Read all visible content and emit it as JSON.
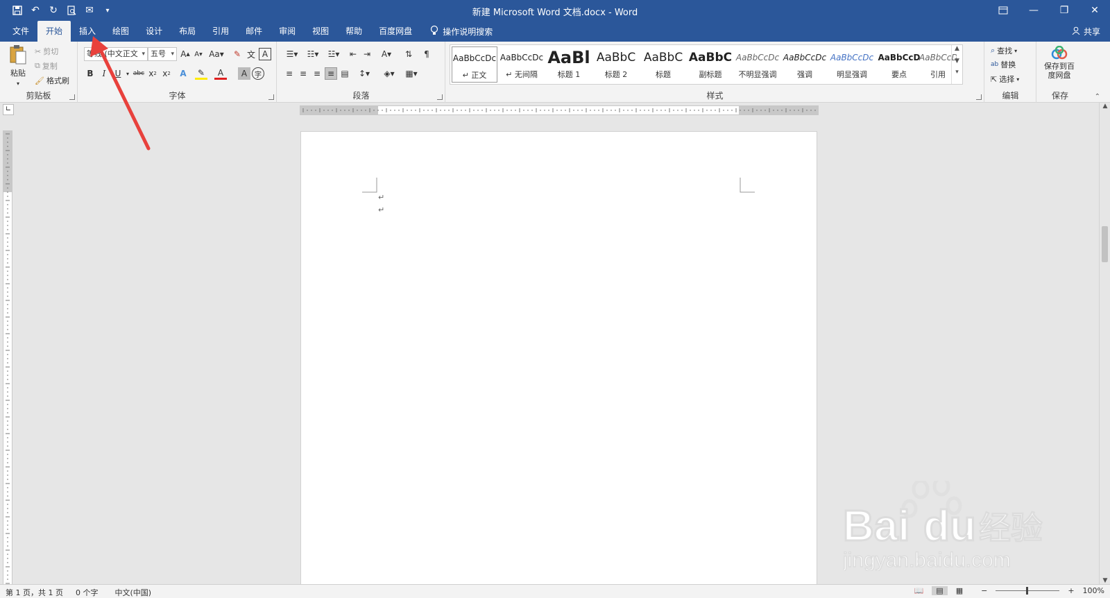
{
  "window": {
    "title": "新建 Microsoft Word 文档.docx  -  Word"
  },
  "tabs": [
    "文件",
    "开始",
    "插入",
    "绘图",
    "设计",
    "布局",
    "引用",
    "邮件",
    "审阅",
    "视图",
    "帮助",
    "百度网盘"
  ],
  "active_tab": "开始",
  "tell_me": "操作说明搜索",
  "share": "共享",
  "ribbon": {
    "clipboard": {
      "paste": "粘贴",
      "cut": "剪切",
      "copy": "复制",
      "format_painter": "格式刷",
      "label": "剪贴板"
    },
    "font": {
      "font_name": "等线 (中文正文",
      "font_size": "五号",
      "label": "字体"
    },
    "paragraph": {
      "label": "段落"
    },
    "styles": {
      "label": "样式",
      "items": [
        {
          "preview": "AaBbCcDc",
          "name": "↵ 正文"
        },
        {
          "preview": "AaBbCcDc",
          "name": "↵ 无间隔"
        },
        {
          "preview": "AaBl",
          "name": "标题 1"
        },
        {
          "preview": "AaBbC",
          "name": "标题 2"
        },
        {
          "preview": "AaBbC",
          "name": "标题"
        },
        {
          "preview": "AaBbC",
          "name": "副标题"
        },
        {
          "preview": "AaBbCcDc",
          "name": "不明显强调"
        },
        {
          "preview": "AaBbCcDc",
          "name": "强调"
        },
        {
          "preview": "AaBbCcDc",
          "name": "明显强调"
        },
        {
          "preview": "AaBbCcD",
          "name": "要点"
        },
        {
          "preview": "AaBbCcDc",
          "name": "引用"
        }
      ]
    },
    "editing": {
      "find": "查找",
      "replace": "替换",
      "select": "选择",
      "label": "编辑"
    },
    "save": {
      "button": "保存到百度网盘",
      "label": "保存"
    }
  },
  "document": {
    "paragraph_marks": [
      "↵",
      "↵"
    ]
  },
  "status": {
    "page": "第 1 页，共 1 页",
    "words": "0 个字",
    "language": "中文(中国)",
    "zoom": "100%"
  },
  "colors": {
    "title_bar": "#2b579a",
    "ribbon_bg": "#f3f3f3",
    "annotation_arrow": "#e8413c"
  },
  "icons": [
    "save-icon",
    "undo-icon",
    "redo-icon",
    "print-preview-icon",
    "lightbulb-icon",
    "person-icon",
    "baidu-cloud-icon"
  ]
}
